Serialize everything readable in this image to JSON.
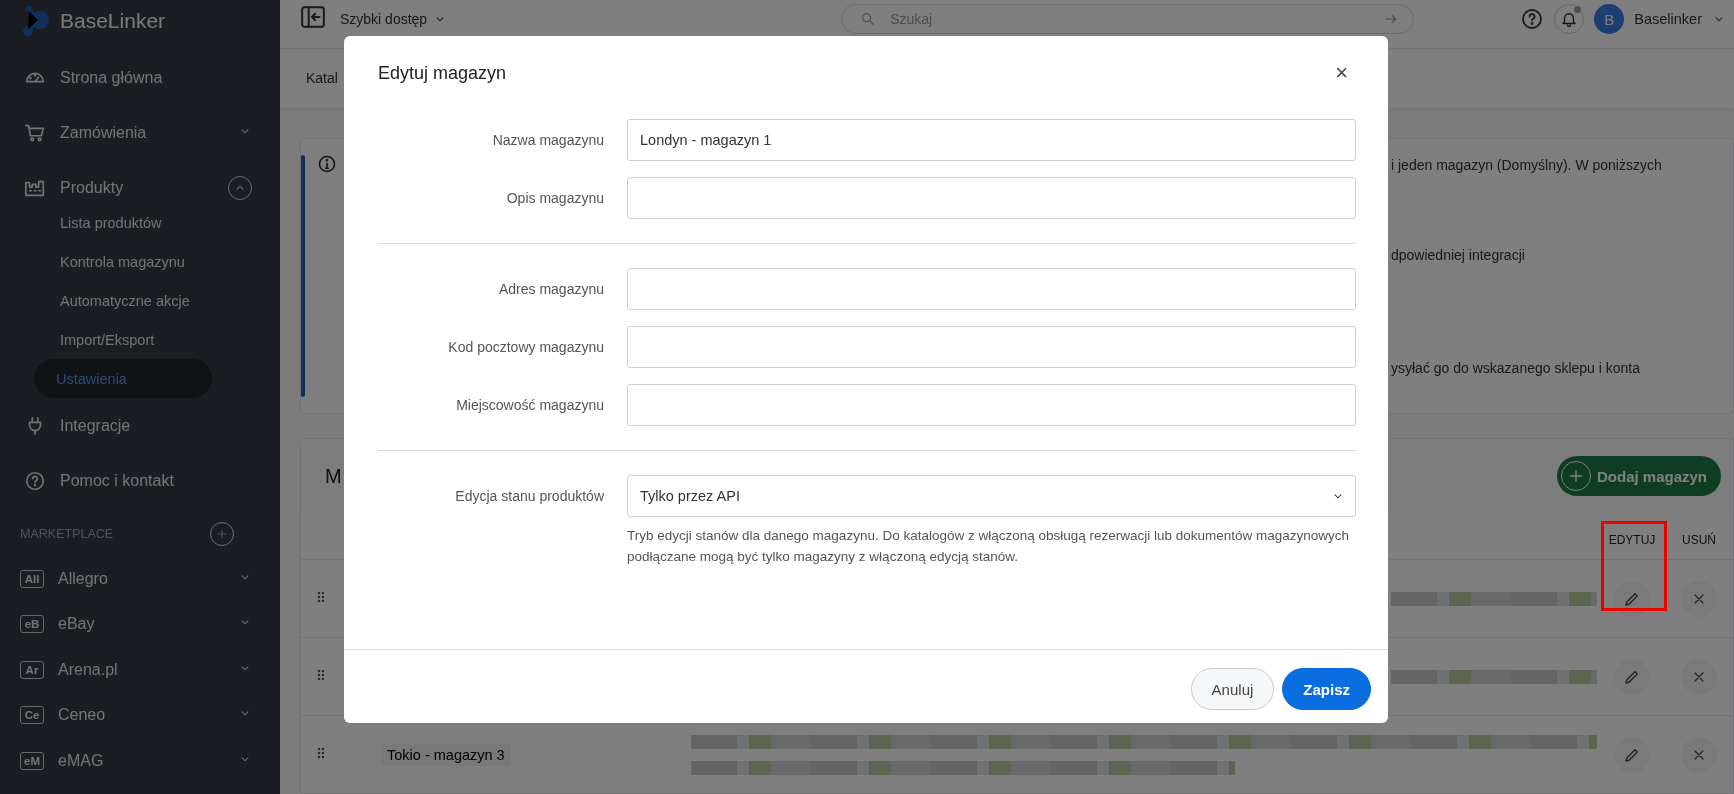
{
  "sidebar": {
    "logo": "BaseLinker",
    "nav": [
      {
        "label": "Strona główna",
        "kind": "gauge"
      },
      {
        "label": "Zamówienia",
        "kind": "cart",
        "expanded": false
      },
      {
        "label": "Produkty",
        "kind": "warehouse",
        "expanded": true,
        "children": [
          {
            "label": "Lista produktów",
            "selected": false
          },
          {
            "label": "Kontrola magazynu",
            "selected": false
          },
          {
            "label": "Automatyczne akcje",
            "selected": false
          },
          {
            "label": "Import/Eksport",
            "selected": false
          },
          {
            "label": "Ustawienia",
            "selected": true
          }
        ]
      },
      {
        "label": "Integracje",
        "kind": "plug"
      },
      {
        "label": "Pomoc i kontakt",
        "kind": "help"
      }
    ],
    "marketplace": {
      "heading": "MARKETPLACE",
      "items": [
        {
          "badge": "All",
          "label": "Allegro",
          "expanded": false
        },
        {
          "badge": "eB",
          "label": "eBay",
          "expanded": false
        },
        {
          "badge": "Ar",
          "label": "Arena.pl",
          "expanded": false
        },
        {
          "badge": "Ce",
          "label": "Ceneo",
          "expanded": false
        },
        {
          "badge": "eM",
          "label": "eMAG",
          "expanded": false
        }
      ]
    }
  },
  "topbar": {
    "quick_access": "Szybki dostęp",
    "search": {
      "placeholder": "Szukaj"
    },
    "notifications_unread": true,
    "avatar": "B",
    "user": "Baselinker"
  },
  "subnav": {
    "label": "Katal"
  },
  "info": {
    "lines": [
      "i jeden magazyn (Domyślny). W poniższych",
      "dpowiedniej integracji",
      "ysyłać go do wskazanego sklepu i konta"
    ]
  },
  "warehouses": {
    "title": "M",
    "add_button": "Dodaj magazyn",
    "columns": [
      "EDYTUJ",
      "USUŃ"
    ],
    "highlight_frame": true,
    "rows": [
      {
        "name": ""
      },
      {
        "name": ""
      },
      {
        "name": "Tokio - magazyn 3"
      }
    ]
  },
  "modal": {
    "title": "Edytuj magazyn",
    "close": "×",
    "sections": [
      [
        {
          "label": "Nazwa magazynu",
          "kind": "text",
          "value": "Londyn - magazyn 1"
        },
        {
          "label": "Opis magazynu",
          "kind": "text"
        }
      ],
      [
        {
          "label": "Adres magazynu",
          "kind": "text"
        },
        {
          "label": "Kod pocztowy magazynu",
          "kind": "text"
        },
        {
          "label": "Miejscowość magazynu",
          "kind": "text"
        }
      ],
      [
        {
          "label": "Edycja stanu produktów",
          "kind": "select",
          "value": "Tylko przez API",
          "help": "Tryb edycji stanów dla danego magazynu. Do katalogów z włączoną obsługą rezerwacji lub dokumentów magazynowych podłączane mogą być tylko magazyny z włączoną edycją stanów."
        }
      ]
    ],
    "buttons": [
      {
        "label": "Anuluj",
        "kind": "secondary"
      },
      {
        "label": "Zapisz",
        "kind": "primary"
      }
    ]
  }
}
